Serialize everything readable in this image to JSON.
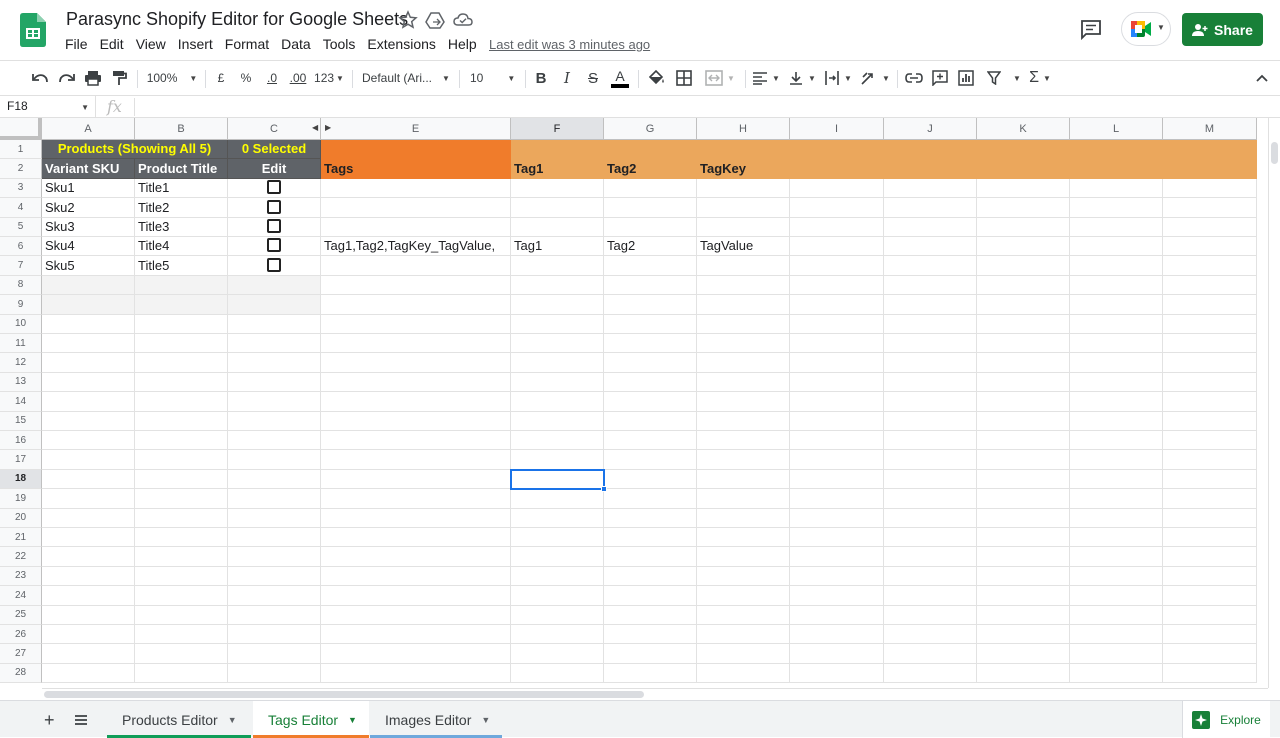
{
  "app": {
    "title": "Parasync Shopify Editor for Google Sheets",
    "last_edit": "Last edit was 3 minutes ago",
    "share_label": "Share"
  },
  "menu": [
    "File",
    "Edit",
    "View",
    "Insert",
    "Format",
    "Data",
    "Tools",
    "Extensions",
    "Help"
  ],
  "toolbar": {
    "zoom": "100%",
    "currency": "£",
    "percent": "%",
    "dec_decrease": ".0",
    "dec_increase": ".00",
    "more_formats": "123",
    "font": "Default (Ari...",
    "font_size": "10"
  },
  "formula_bar": {
    "cell_ref": "F18",
    "fx": "fx",
    "value": ""
  },
  "columns": [
    "A",
    "B",
    "C",
    "",
    "E",
    "F",
    "G",
    "H",
    "I",
    "J",
    "K",
    "L",
    "M"
  ],
  "rows": [
    "1",
    "2",
    "3",
    "4",
    "5",
    "6",
    "7",
    "8",
    "9",
    "10",
    "11",
    "12",
    "13",
    "14",
    "15",
    "16",
    "17",
    "18",
    "19",
    "20",
    "21",
    "22",
    "23",
    "24",
    "25",
    "26",
    "27",
    "28"
  ],
  "sheet": {
    "header1": {
      "products": "Products (Showing All 5)",
      "selected": "0 Selected"
    },
    "header2": {
      "a": "Variant SKU",
      "b": "Product Title",
      "c": "Edit",
      "e": "Tags",
      "f": "Tag1",
      "g": "Tag2",
      "h": "TagKey"
    },
    "data": [
      {
        "sku": "Sku1",
        "title": "Title1",
        "tags": "",
        "tag1": "",
        "tag2": "",
        "tagkey": ""
      },
      {
        "sku": "Sku2",
        "title": "Title2",
        "tags": "",
        "tag1": "",
        "tag2": "",
        "tagkey": ""
      },
      {
        "sku": "Sku3",
        "title": "Title3",
        "tags": "",
        "tag1": "",
        "tag2": "",
        "tagkey": ""
      },
      {
        "sku": "Sku4",
        "title": "Title4",
        "tags": "Tag1,Tag2,TagKey_TagValue,",
        "tag1": "Tag1",
        "tag2": "Tag2",
        "tagkey": "TagValue"
      },
      {
        "sku": "Sku5",
        "title": "Title5",
        "tags": "",
        "tag1": "",
        "tag2": "",
        "tagkey": ""
      }
    ]
  },
  "tabs": [
    {
      "label": "Products Editor",
      "color": "#0f9d58"
    },
    {
      "label": "Tags Editor",
      "color": "#f07c2b",
      "active": true
    },
    {
      "label": "Images Editor",
      "color": "#6fa8dc"
    }
  ],
  "explore_label": "Explore",
  "colors": {
    "share": "#188038",
    "header_dark": "#5f6368",
    "header_yellow": "#ffff00",
    "tags_orange": "#f07c2b",
    "tags_light_orange": "#eba75c",
    "selection": "#1a73e8"
  }
}
